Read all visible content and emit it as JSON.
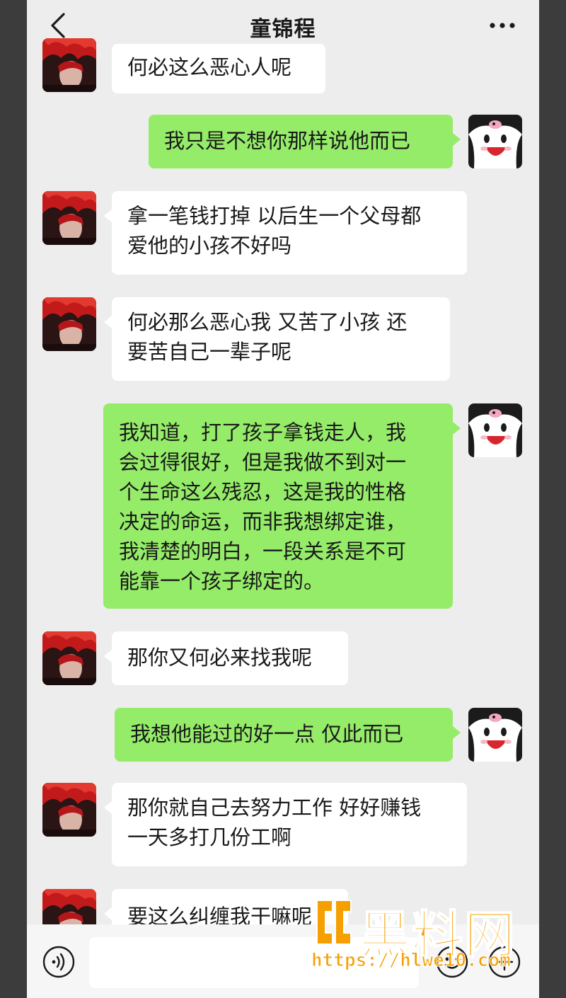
{
  "header": {
    "title": "童锦程"
  },
  "messages": [
    {
      "from": "other",
      "lines": [
        "何必这么恶心人呢"
      ]
    },
    {
      "from": "me",
      "lines": [
        "我只是不想你那样说他而已"
      ]
    },
    {
      "from": "other",
      "lines": [
        "拿一笔钱打掉 以后生一个父母都",
        "爱他的小孩不好吗"
      ]
    },
    {
      "from": "other",
      "lines": [
        "何必那么恶心我 又苦了小孩 还",
        "要苦自己一辈子呢"
      ]
    },
    {
      "from": "me",
      "lines": [
        "我知道，打了孩子拿钱走人，我",
        "会过得很好，但是我做不到对一",
        "个生命这么残忍，这是我的性格",
        "决定的命运，而非我想绑定谁，",
        "我清楚的明白，一段关系是不可",
        "能靠一个孩子绑定的。"
      ]
    },
    {
      "from": "other",
      "lines": [
        "那你又何必来找我呢"
      ]
    },
    {
      "from": "me",
      "lines": [
        "我想他能过的好一点 仅此而已"
      ]
    },
    {
      "from": "other",
      "lines": [
        "那你就自己去努力工作 好好赚钱",
        "一天多打几份工啊"
      ]
    },
    {
      "from": "other",
      "lines": [
        "要这么纠缠我干嘛呢"
      ]
    }
  ],
  "watermark": {
    "name": "黑料网",
    "url": "https://hlwe10.com"
  },
  "colors": {
    "bubble_me": "#95ec69",
    "bubble_other": "#ffffff",
    "background": "#ededed",
    "watermark": "#f5a000"
  },
  "icons": {
    "back": "chevron-left-icon",
    "more": "ellipsis-icon",
    "voice": "voice-icon",
    "emoji": "emoji-icon",
    "plus": "plus-icon"
  }
}
